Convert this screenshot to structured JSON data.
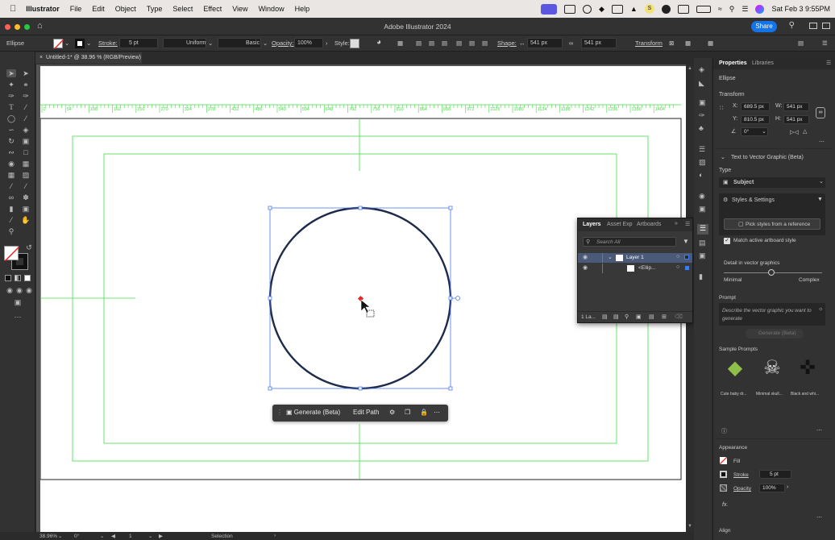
{
  "menubar": {
    "app": "Illustrator",
    "items": [
      "File",
      "Edit",
      "Object",
      "Type",
      "Select",
      "Effect",
      "View",
      "Window",
      "Help"
    ],
    "datetime": "Sat Feb 3  9:55PM"
  },
  "window": {
    "title": "Adobe Illustrator 2024",
    "share": "Share"
  },
  "control": {
    "object": "Ellipse",
    "stroke_label": "Stroke:",
    "stroke_value": "5 pt",
    "profile": "Uniform",
    "brush": "Basic",
    "opacity_label": "Opacity:",
    "opacity_value": "100%",
    "style_label": "Style:",
    "shape_label": "Shape:",
    "shape_w": "541 px",
    "shape_h": "541 px",
    "transform": "Transform"
  },
  "doc": {
    "tab": "Untitled-1* @ 38.96 % (RGB/Preview)"
  },
  "ruler": {
    "ticks": [
      "0",
      "54",
      "108",
      "162",
      "216",
      "270",
      "324",
      "378",
      "432",
      "486",
      "540",
      "594",
      "648",
      "702",
      "756",
      "810",
      "864",
      "918",
      "972",
      "1026",
      "1080",
      "1134",
      "1188",
      "1242",
      "1296",
      "1350",
      "1404"
    ]
  },
  "context": {
    "generate": "Generate (Beta)",
    "edit": "Edit Path"
  },
  "layers": {
    "tabs": [
      "Layers",
      "Asset Exp",
      "Artboards"
    ],
    "search": "Search All",
    "layer1": "Layer 1",
    "item": "<Ellip...",
    "footer": "1 La..."
  },
  "props": {
    "tabs": [
      "Properties",
      "Libraries"
    ],
    "object": "Ellipse",
    "transform": "Transform",
    "x_label": "X:",
    "x": "689.5 px",
    "y_label": "Y:",
    "y": "810.5 px",
    "w_label": "W:",
    "w": "541 px",
    "h_label": "H:",
    "h": "541 px",
    "angle": "0°",
    "tvg": "Text to Vector Graphic (Beta)",
    "type_label": "Type",
    "type_value": "Subject",
    "styles": "Styles & Settings",
    "pick": "Pick styles from a reference",
    "match": "Match active artboard style",
    "detail": "Detail in vector graphics",
    "minimal": "Minimal",
    "complex": "Complex",
    "prompt": "Prompt",
    "prompt_placeholder": "Describe the vector graphic you want to generate",
    "gen": "Generate (Beta)",
    "samples": "Sample Prompts",
    "s1": "Cute baby dr...",
    "s2": "Minimal skull...",
    "s3": "Black and whi...",
    "appearance": "Appearance",
    "fill": "Fill",
    "stroke": "Stroke",
    "stroke_value": "5 pt",
    "opacity": "Opacity",
    "opacity_value": "100%",
    "fx": "fx.",
    "align": "Align"
  },
  "status": {
    "zoom": "38.96%",
    "angle": "0°",
    "artboard": "1",
    "mode": "Selection"
  },
  "colors": {
    "guide": "#44dd44",
    "ellipse": "#1d2a4a",
    "select": "#4a7cf0",
    "accent": "#1473e6"
  }
}
